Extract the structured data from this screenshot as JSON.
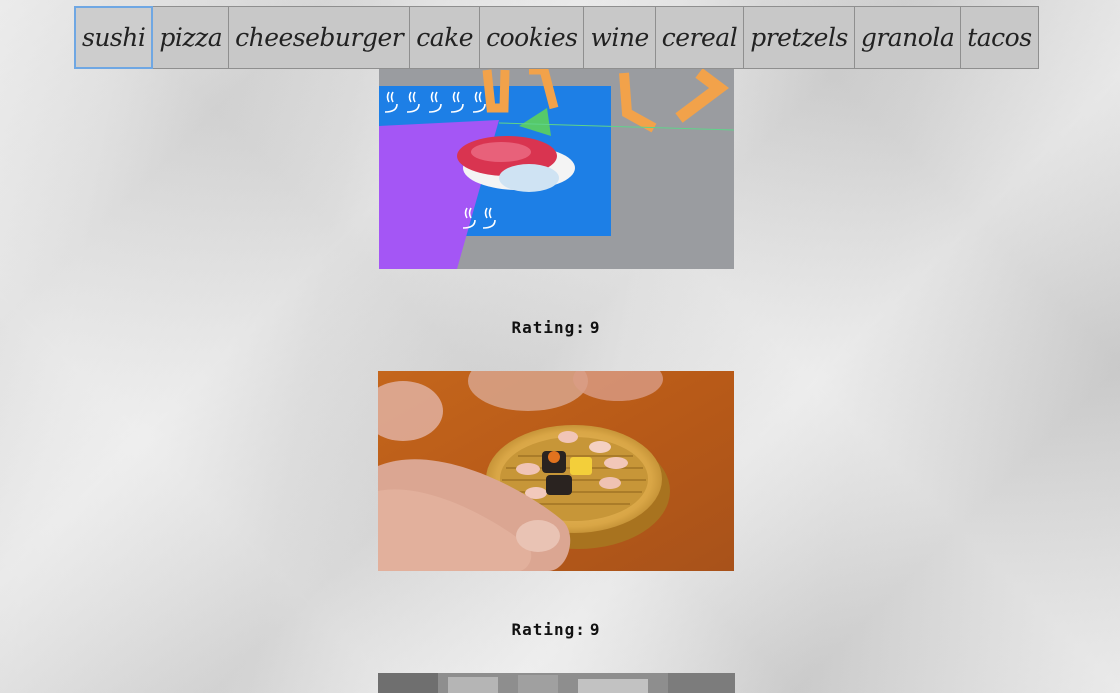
{
  "tabs": [
    {
      "label": "sushi",
      "active": true
    },
    {
      "label": "pizza",
      "active": false
    },
    {
      "label": "cheeseburger",
      "active": false
    },
    {
      "label": "cake",
      "active": false
    },
    {
      "label": "cookies",
      "active": false
    },
    {
      "label": "wine",
      "active": false
    },
    {
      "label": "cereal",
      "active": false
    },
    {
      "label": "pretzels",
      "active": false
    },
    {
      "label": "granola",
      "active": false
    },
    {
      "label": "tacos",
      "active": false
    }
  ],
  "feed": {
    "rating_label": "Rating:",
    "items": [
      {
        "rating": "9"
      },
      {
        "rating": "9"
      }
    ]
  },
  "colors": {
    "active_tab_border": "#6fa7e3",
    "tab_background": "#c8c8c8"
  }
}
